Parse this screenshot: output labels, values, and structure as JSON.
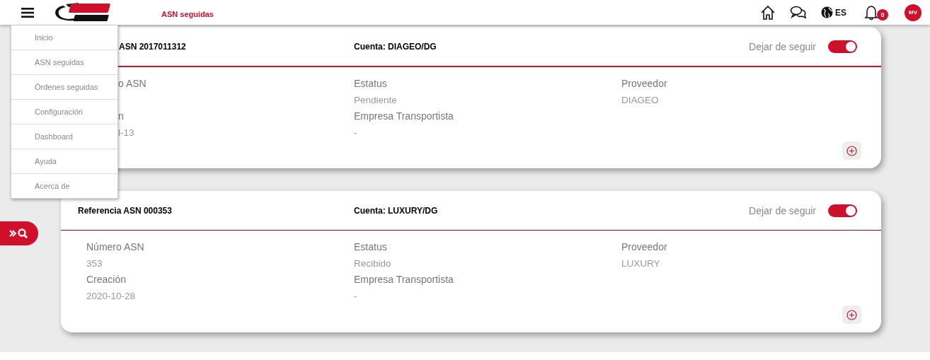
{
  "header": {
    "page_title": "ASN seguidas",
    "language": "ES",
    "notifications": "0",
    "avatar": "MV"
  },
  "menu": {
    "open": true,
    "items": [
      {
        "label": "Inicio"
      },
      {
        "label": "ASN seguidas"
      },
      {
        "label": "Órdenes seguidas"
      },
      {
        "label": "Configuración"
      },
      {
        "label": "Dashboard"
      },
      {
        "label": "Ayuda"
      },
      {
        "label": "Acerca de"
      }
    ]
  },
  "cards": [
    {
      "partial": true,
      "reference": "ASN 2017011312",
      "account": "Cuenta: DIAGEO/DG",
      "follow_label": "Dejar de seguir",
      "following": true,
      "columns": [
        [
          {
            "label": "o ASN"
          },
          {
            "label": "n",
            "value": "l-13"
          }
        ],
        [
          {
            "label": "Estatus",
            "value": "Pendiente"
          },
          {
            "label": "Empresa Transportista",
            "value": "-"
          }
        ],
        [
          {
            "label": "Proveedor",
            "value": "DIAGEO"
          }
        ]
      ]
    },
    {
      "partial": false,
      "reference": "Referencia ASN 000353",
      "account": "Cuenta: LUXURY/DG",
      "follow_label": "Dejar de seguir",
      "following": true,
      "columns": [
        [
          {
            "label": "Número ASN",
            "value": "353"
          },
          {
            "label": "Creación",
            "value": "2020-10-28"
          }
        ],
        [
          {
            "label": "Estatus",
            "value": "Recibido"
          },
          {
            "label": "Empresa Transportista",
            "value": "-"
          }
        ],
        [
          {
            "label": "Proveedor",
            "value": "LUXURY"
          }
        ]
      ]
    }
  ]
}
